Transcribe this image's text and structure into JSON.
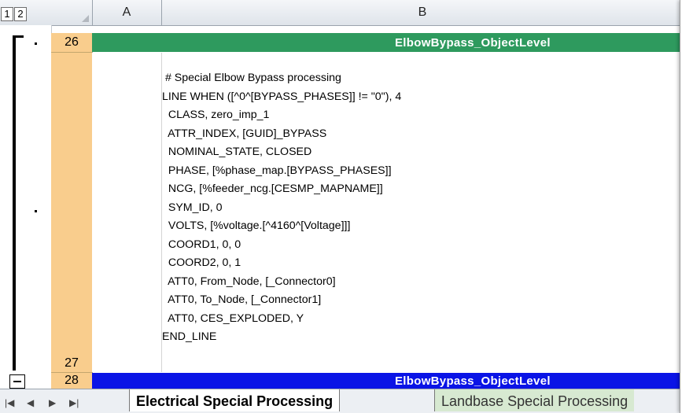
{
  "outline_levels": [
    "1",
    "2"
  ],
  "columns": [
    {
      "label": "A"
    },
    {
      "label": "B"
    }
  ],
  "rows": {
    "r26": "26",
    "r27": "27",
    "r28": "28"
  },
  "band_top": {
    "text": "ElbowBypass_ObjectLevel",
    "color": "#2e9a5e"
  },
  "band_bottom": {
    "text": "ElbowBypass_ObjectLevel",
    "color": "#0a14e6"
  },
  "cell_lines": [
    " # Special Elbow Bypass processing",
    "LINE WHEN ([^0^[BYPASS_PHASES]] != \"0\"), 4",
    "  CLASS, zero_imp_1",
    "  ATTR_INDEX, [GUID]_BYPASS",
    "  NOMINAL_STATE, CLOSED",
    "  PHASE, [%phase_map.[BYPASS_PHASES]]",
    "  NCG, [%feeder_ncg.[CESMP_MAPNAME]]",
    "  SYM_ID, 0",
    "  VOLTS, [%voltage.[^4160^[Voltage]]]",
    "  COORD1, 0, 0",
    "  COORD2, 0, 1",
    "  ATT0, From_Node, [_Connector0]",
    "  ATT0, To_Node, [_Connector1]",
    "  ATT0, CES_EXPLODED, Y",
    "END_LINE"
  ],
  "sheet_tabs": {
    "active": "Electrical Special Processing",
    "next": "Landbase Special Processing"
  }
}
